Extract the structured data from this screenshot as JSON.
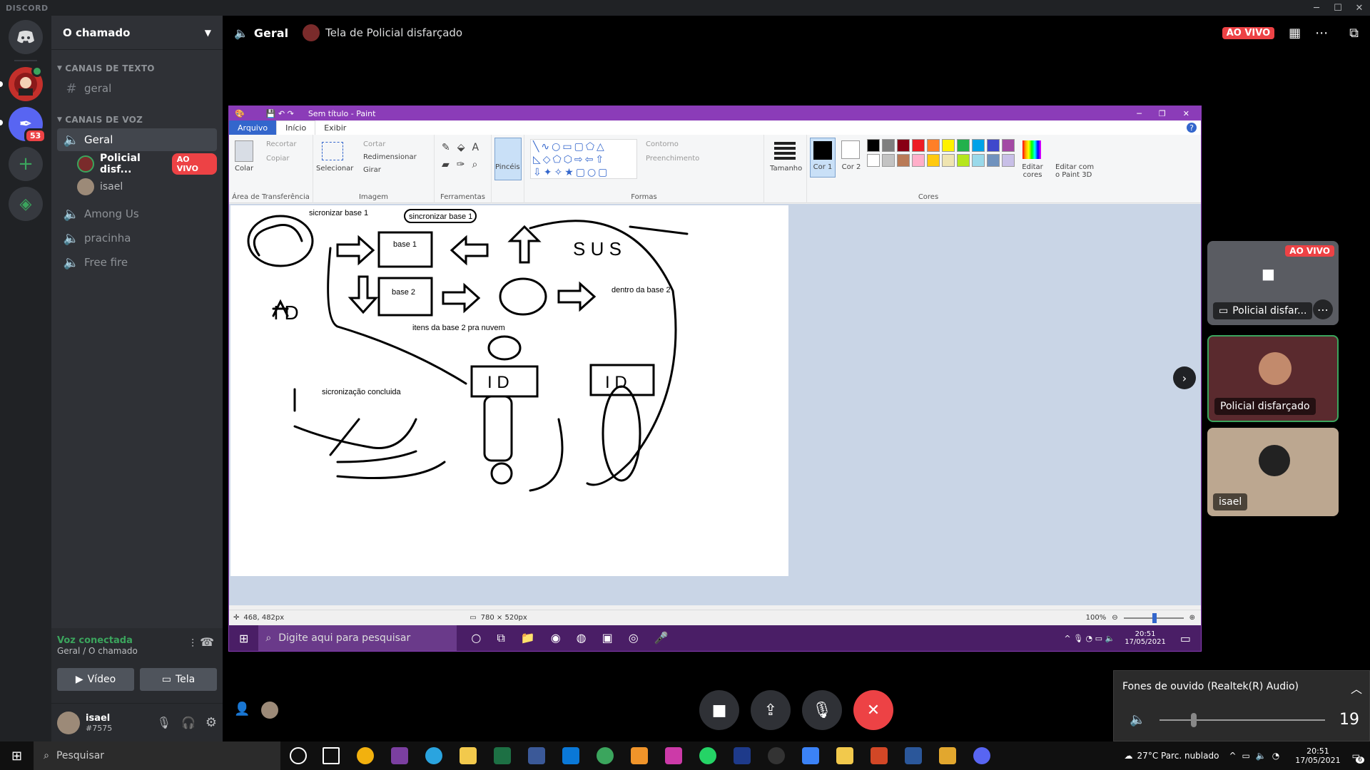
{
  "app": {
    "brand": "DISCORD"
  },
  "servers": {
    "badge_count": "53"
  },
  "sidebar": {
    "guild_name": "O chamado",
    "text_category": "CANAIS DE TEXTO",
    "text_channels": [
      "geral"
    ],
    "voice_category": "CANAIS DE VOZ",
    "voice_active": "Geral",
    "voice_users": [
      {
        "name": "Policial disf...",
        "badge": "AO VIVO"
      },
      {
        "name": "isael"
      }
    ],
    "voice_channels": [
      "Among Us",
      "pracinha",
      "Free fire"
    ]
  },
  "voice_connection": {
    "status": "Voz conectada",
    "location": "Geral / O chamado",
    "video_label": "Vídeo",
    "screen_label": "Tela"
  },
  "user_panel": {
    "name": "isael",
    "tag": "#7575"
  },
  "header": {
    "channel": "Geral",
    "stream_title": "Tela de Policial disfarçado",
    "live_badge": "AO VIVO"
  },
  "paint": {
    "title": "Sem título - Paint",
    "tabs": [
      "Arquivo",
      "Início",
      "Exibir"
    ],
    "clipboard": {
      "paste": "Colar",
      "cut": "Recortar",
      "copy": "Copiar",
      "label": "Área de Transferência"
    },
    "image": {
      "select": "Selecionar",
      "crop": "Cortar",
      "resize": "Redimensionar",
      "rotate": "Girar",
      "label": "Imagem"
    },
    "tools_label": "Ferramentas",
    "brushes": "Pincéis",
    "shapes": {
      "outline": "Contorno",
      "fill": "Preenchimento",
      "label": "Formas"
    },
    "size": "Tamanho",
    "color1": "Cor 1",
    "color2": "Cor 2",
    "edit_colors": "Editar cores",
    "paint3d": "Editar com o Paint 3D",
    "colors_label": "Cores",
    "palette": [
      "#000000",
      "#7f7f7f",
      "#880015",
      "#ed1c24",
      "#ff7f27",
      "#fff200",
      "#22b14c",
      "#00a2e8",
      "#3f48cc",
      "#a349a4",
      "#ffffff",
      "#c3c3c3",
      "#b97a57",
      "#ffaec9",
      "#ffc90e",
      "#efe4b0",
      "#b5e61d",
      "#99d9ea",
      "#7092be",
      "#c8bfe7"
    ],
    "status": {
      "pos": "468, 482px",
      "size": "780 × 520px",
      "zoom": "100%"
    },
    "canvas_texts": {
      "t1": "sicronizar base 1",
      "t2": "sincronizar base 1",
      "base1": "base 1",
      "base2": "base 2",
      "dentro": "dentro da base 2",
      "itens": "itens da base 2 pra nuvem",
      "concluida": "sicronização concluida",
      "sus": "S U S",
      "id": "I D"
    },
    "inner_taskbar": {
      "search": "Digite aqui para pesquisar",
      "time": "20:51",
      "date": "17/05/2021"
    }
  },
  "tiles": [
    {
      "label": "Policial disfar...",
      "badge": "AO VIVO"
    },
    {
      "label": "Policial disfarçado"
    },
    {
      "label": "isael"
    }
  ],
  "audio_popup": {
    "device": "Fones de ouvido (Realtek(R) Audio)",
    "volume": "19"
  },
  "taskbar": {
    "search": "Pesquisar",
    "weather": "27°C  Parc. nublado",
    "time": "20:51",
    "date": "17/05/2021",
    "notif": "6"
  }
}
